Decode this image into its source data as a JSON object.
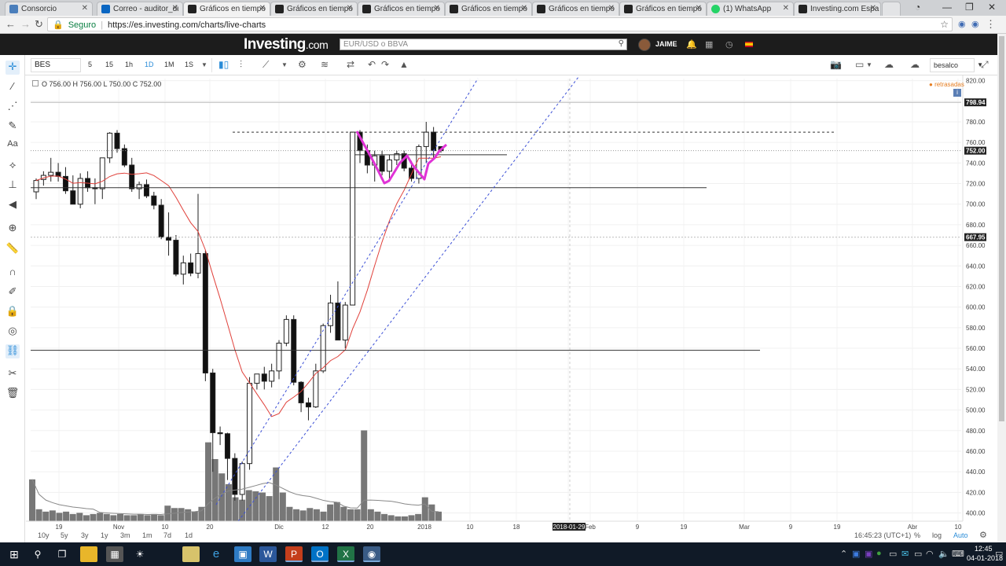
{
  "browser": {
    "tabs": [
      {
        "label": "Consorcio",
        "fav": "#4a7ebb"
      },
      {
        "label": "Correo - auditor_dι",
        "fav": "#0a66c2"
      },
      {
        "label": "Gráficos en tiempo",
        "fav": "#222222"
      },
      {
        "label": "Gráficos en tiempo",
        "fav": "#222222"
      },
      {
        "label": "Gráficos en tiempo",
        "fav": "#222222"
      },
      {
        "label": "Gráficos en tiempo",
        "fav": "#222222"
      },
      {
        "label": "Gráficos en tiempo",
        "fav": "#222222"
      },
      {
        "label": "Gráficos en tiempo",
        "fav": "#222222"
      },
      {
        "label": "(1) WhatsApp",
        "fav": "#25d366"
      },
      {
        "label": "Investing.com Espa",
        "fav": "#222222"
      }
    ],
    "active_tab": 2,
    "secure_label": "Seguro",
    "url": "https://es.investing.com/charts/live-charts"
  },
  "site": {
    "logo": "Investing",
    "logo_domain": ".com",
    "search_placeholder": "EUR/USD o BBVA",
    "user_name": "JAIME"
  },
  "toolbar": {
    "symbol": "BES",
    "timeframes": [
      "5",
      "15",
      "1h",
      "1D",
      "1M",
      "1S"
    ],
    "active_timeframe": "1D",
    "account_label": "besalco"
  },
  "chart": {
    "ohlc_text": "O 756.00 H 756.00 L 750.00 C 752.00",
    "delayed_label": "retrasadas",
    "price_axis": [
      "820.00",
      "800.00",
      "780.00",
      "760.00",
      "740.00",
      "720.00",
      "700.00",
      "680.00",
      "660.00",
      "640.00",
      "620.00",
      "600.00",
      "580.00",
      "560.00",
      "540.00",
      "520.00",
      "500.00",
      "480.00",
      "460.00",
      "440.00",
      "420.00",
      "400.00"
    ],
    "price_markers": [
      {
        "label": "798.94",
        "value": 798.94
      },
      {
        "label": "752.00",
        "value": 752
      },
      {
        "label": "667.95",
        "value": 667.95
      }
    ],
    "time_axis": [
      "19",
      "Nov",
      "10",
      "20",
      "Dic",
      "12",
      "20",
      "2018",
      "10",
      "18",
      "2018-01-29",
      "Feb",
      "9",
      "19",
      "Mar",
      "9",
      "19",
      "Abr",
      "10"
    ]
  },
  "chart_data": {
    "type": "candlestick",
    "symbol": "BES",
    "ylim": [
      392,
      822
    ],
    "candles": [
      {
        "o": 712,
        "h": 725,
        "l": 705,
        "c": 723
      },
      {
        "o": 724,
        "h": 732,
        "l": 718,
        "c": 728
      },
      {
        "o": 728,
        "h": 745,
        "l": 722,
        "c": 731
      },
      {
        "o": 731,
        "h": 740,
        "l": 722,
        "c": 727
      },
      {
        "o": 727,
        "h": 736,
        "l": 710,
        "c": 713
      },
      {
        "o": 713,
        "h": 728,
        "l": 702,
        "c": 700
      },
      {
        "o": 700,
        "h": 730,
        "l": 696,
        "c": 725
      },
      {
        "o": 725,
        "h": 732,
        "l": 712,
        "c": 716
      },
      {
        "o": 716,
        "h": 725,
        "l": 700,
        "c": 715
      },
      {
        "o": 715,
        "h": 740,
        "l": 705,
        "c": 745
      },
      {
        "o": 745,
        "h": 770,
        "l": 740,
        "c": 769
      },
      {
        "o": 769,
        "h": 772,
        "l": 750,
        "c": 754
      },
      {
        "o": 754,
        "h": 758,
        "l": 736,
        "c": 738
      },
      {
        "o": 738,
        "h": 745,
        "l": 712,
        "c": 715
      },
      {
        "o": 715,
        "h": 722,
        "l": 705,
        "c": 719
      },
      {
        "o": 719,
        "h": 724,
        "l": 706,
        "c": 708
      },
      {
        "o": 708,
        "h": 712,
        "l": 695,
        "c": 699
      },
      {
        "o": 699,
        "h": 705,
        "l": 666,
        "c": 668
      },
      {
        "o": 668,
        "h": 692,
        "l": 650,
        "c": 665
      },
      {
        "o": 665,
        "h": 670,
        "l": 630,
        "c": 632
      },
      {
        "o": 632,
        "h": 650,
        "l": 622,
        "c": 643
      },
      {
        "o": 643,
        "h": 652,
        "l": 630,
        "c": 633
      },
      {
        "o": 633,
        "h": 710,
        "l": 628,
        "c": 652
      },
      {
        "o": 652,
        "h": 655,
        "l": 528,
        "c": 536
      },
      {
        "o": 536,
        "h": 540,
        "l": 440,
        "c": 478
      },
      {
        "o": 478,
        "h": 484,
        "l": 466,
        "c": 477
      },
      {
        "o": 477,
        "h": 478,
        "l": 432,
        "c": 453
      },
      {
        "o": 453,
        "h": 458,
        "l": 412,
        "c": 418
      },
      {
        "o": 418,
        "h": 450,
        "l": 412,
        "c": 448
      },
      {
        "o": 448,
        "h": 532,
        "l": 442,
        "c": 526
      },
      {
        "o": 526,
        "h": 535,
        "l": 520,
        "c": 535
      },
      {
        "o": 535,
        "h": 542,
        "l": 520,
        "c": 528
      },
      {
        "o": 528,
        "h": 545,
        "l": 522,
        "c": 538
      },
      {
        "o": 538,
        "h": 568,
        "l": 530,
        "c": 565
      },
      {
        "o": 565,
        "h": 592,
        "l": 562,
        "c": 588
      },
      {
        "o": 588,
        "h": 592,
        "l": 524,
        "c": 527
      },
      {
        "o": 527,
        "h": 528,
        "l": 498,
        "c": 507
      },
      {
        "o": 507,
        "h": 512,
        "l": 490,
        "c": 503
      },
      {
        "o": 503,
        "h": 545,
        "l": 502,
        "c": 538
      },
      {
        "o": 538,
        "h": 584,
        "l": 536,
        "c": 582
      },
      {
        "o": 582,
        "h": 612,
        "l": 575,
        "c": 604
      },
      {
        "o": 604,
        "h": 625,
        "l": 570,
        "c": 568
      },
      {
        "o": 568,
        "h": 605,
        "l": 560,
        "c": 602
      },
      {
        "o": 602,
        "h": 770,
        "l": 660,
        "c": 770
      },
      {
        "o": 770,
        "h": 772,
        "l": 740,
        "c": 752
      },
      {
        "o": 752,
        "h": 758,
        "l": 730,
        "c": 738
      },
      {
        "o": 738,
        "h": 752,
        "l": 722,
        "c": 747
      },
      {
        "o": 747,
        "h": 752,
        "l": 728,
        "c": 732
      },
      {
        "o": 732,
        "h": 748,
        "l": 722,
        "c": 743
      },
      {
        "o": 743,
        "h": 752,
        "l": 738,
        "c": 749
      },
      {
        "o": 749,
        "h": 752,
        "l": 732,
        "c": 735
      },
      {
        "o": 735,
        "h": 742,
        "l": 722,
        "c": 725
      },
      {
        "o": 725,
        "h": 758,
        "l": 720,
        "c": 756
      },
      {
        "o": 756,
        "h": 780,
        "l": 740,
        "c": 770
      },
      {
        "o": 770,
        "h": 775,
        "l": 745,
        "c": 752
      },
      {
        "o": 756,
        "h": 756,
        "l": 750,
        "c": 752
      }
    ],
    "volume_scale_max": 100,
    "volumes": [
      35,
      10,
      8,
      9,
      7,
      8,
      6,
      7,
      5,
      6,
      7,
      6,
      5,
      6,
      5,
      5,
      6,
      5,
      6,
      5,
      13,
      11,
      11,
      10,
      8,
      12,
      66,
      52,
      40,
      31,
      20,
      18,
      26,
      25,
      24,
      21,
      45,
      24,
      12,
      10,
      9,
      11,
      10,
      8,
      14,
      16,
      12,
      10,
      10,
      76,
      10,
      8,
      6,
      5,
      4,
      4,
      5,
      6,
      20,
      14,
      8
    ]
  },
  "range_bar": {
    "ranges": [
      "10y",
      "5y",
      "3y",
      "1y",
      "3m",
      "1m",
      "7d",
      "1d"
    ],
    "clock": "16:45:23 (UTC+1)",
    "options": [
      "%",
      "log",
      "Auto"
    ]
  },
  "taskbar": {
    "time": "12:45",
    "date": "04-01-2018"
  }
}
